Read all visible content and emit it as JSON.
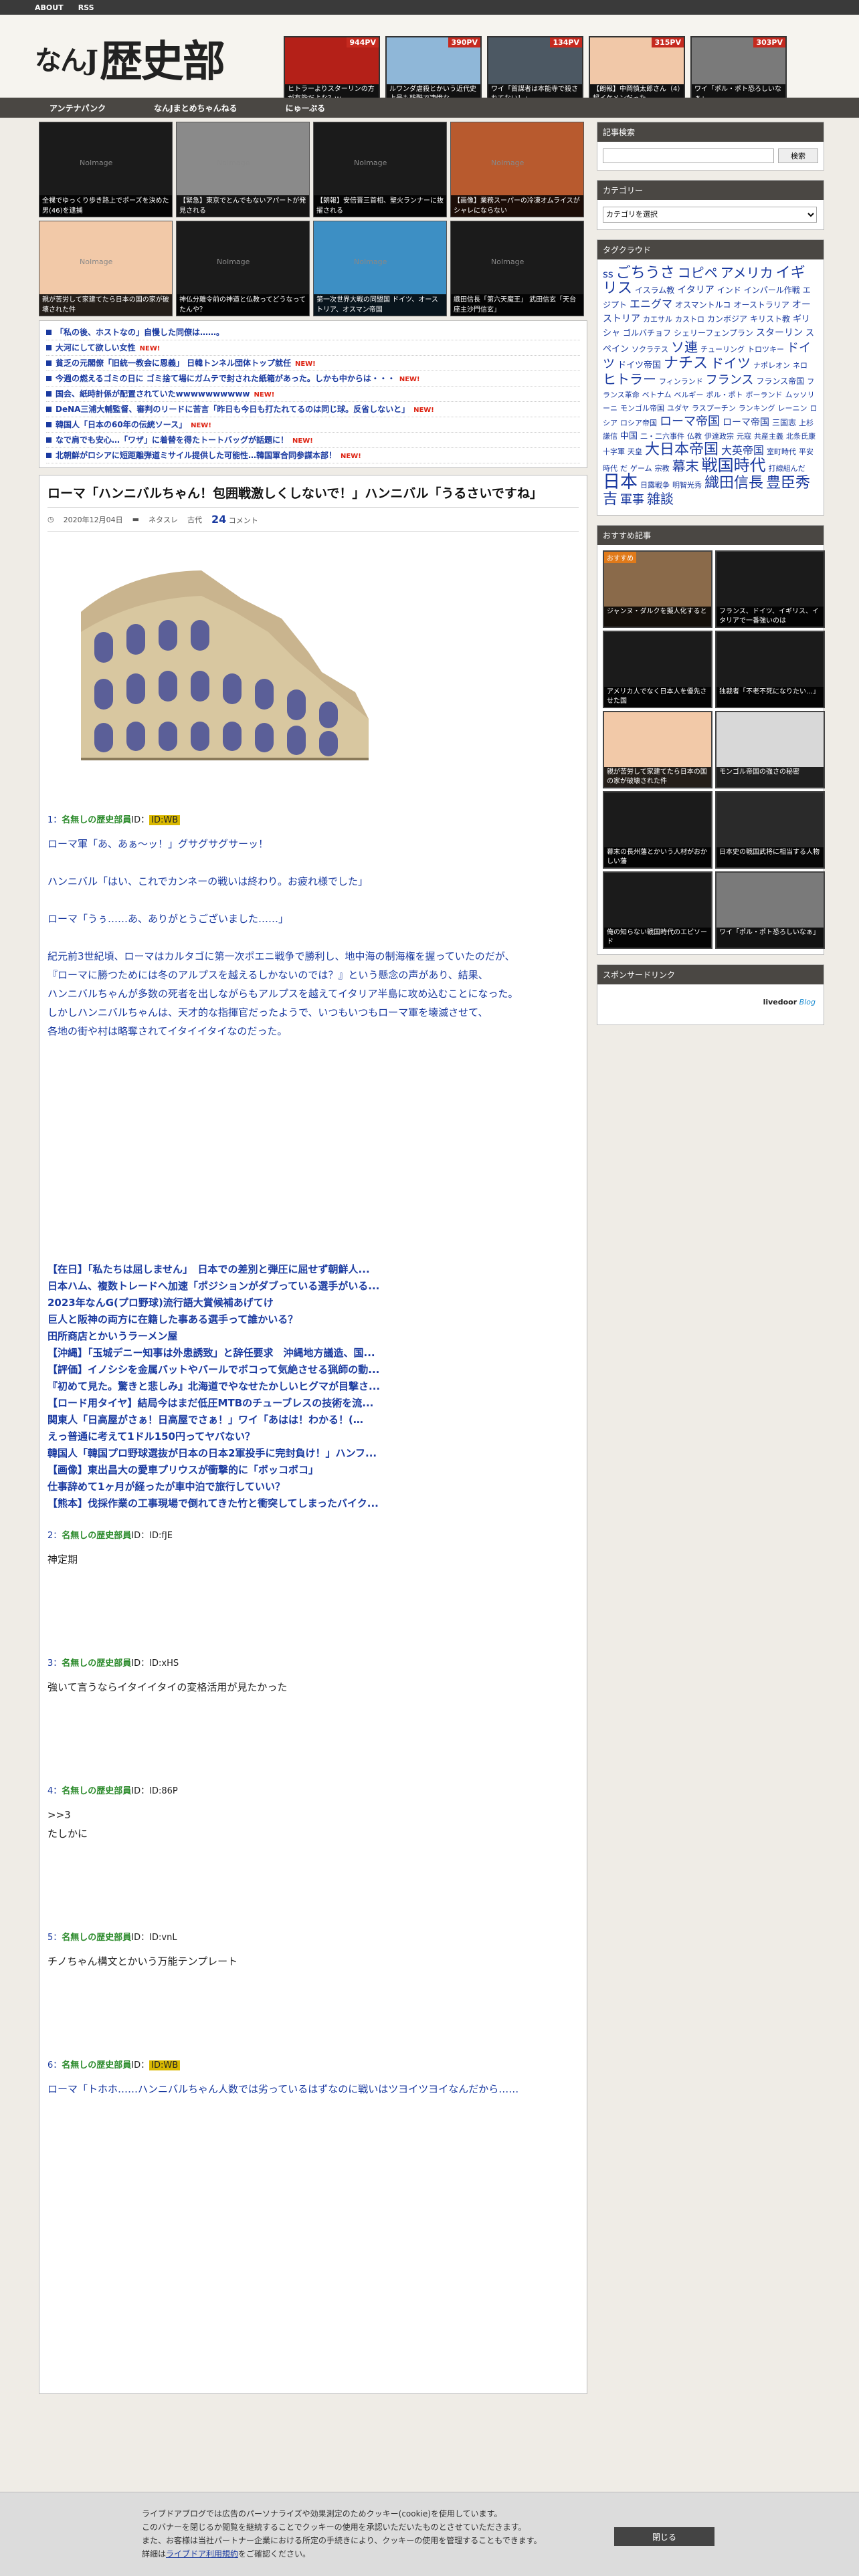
{
  "topbar": {
    "about": "ABOUT",
    "rss": "RSS"
  },
  "logo": {
    "prefix": "なんJ",
    "main": "歴史部"
  },
  "pv_items": [
    {
      "count": "944PV",
      "caption": "ヒトラーよりスターリンの方が有能だよな？ｗ",
      "color": "#b42018"
    },
    {
      "count": "390PV",
      "caption": "ルワンダ虐殺とかいう近代史上最も残酷で凄惨な…",
      "color": "#8fb7d8"
    },
    {
      "count": "134PV",
      "caption": "ワイ「首謀者は本能寺で殺されてない！」",
      "color": "#4c5863"
    },
    {
      "count": "315PV",
      "caption": "【朗報】中岡慎太郎さん（4）超イケメンだった",
      "color": "#f1c8a8"
    },
    {
      "count": "303PV",
      "caption": "ワイ「ポル・ポト恐ろしいなぁ」",
      "color": "#7a7a7a"
    }
  ],
  "nav": [
    "アンテナパンク",
    "なんJまとめちゃんねる",
    "にゅーぷる"
  ],
  "noimage": "NoImage",
  "grid_tiles": [
    {
      "caption": "全裸でゆっくり歩き路上でポーズを決めた男(46)を逮捕",
      "color": "#1b1b1b"
    },
    {
      "caption": "【緊急】東京でとんでもないアパートが発見される",
      "color": "#8a8a8a"
    },
    {
      "caption": "【朗報】安倍晋三首相、聖火ランナーに抜擢される",
      "color": "#1b1b1b"
    },
    {
      "caption": "【画像】業務スーパーの冷凍オムライスがシャレにならない",
      "color": "#b85a2e"
    },
    {
      "caption": "親が苦労して家建てたら日本の国の家が破壊された件",
      "color": "#f2c9a8"
    },
    {
      "caption": "神仏分離令前の神道と仏教ってどうなってたんや？",
      "color": "#1b1b1b"
    },
    {
      "caption": "第一次世界大戦の同盟国 ドイツ、オーストリア、オスマン帝国",
      "color": "#3d8fc4"
    },
    {
      "caption": "織田信長「第六天魔王」 武田信玄「天台座主沙門信玄」",
      "color": "#1b1b1b"
    }
  ],
  "news": [
    {
      "text": "「私の後、ホストなの」自慢した同僚は……。",
      "new": ""
    },
    {
      "text": "大河にして欲しい女性",
      "new": "NEW!"
    },
    {
      "text": "貧乏の元閣僚「旧統一教会に恩義」 日韓トンネル団体トップ就任",
      "new": "NEW!"
    },
    {
      "text": "今週の燃えるゴミの日に ゴミ捨て場にガムテで封された紙箱があった。しかも中からは・・・",
      "new": "NEW!"
    },
    {
      "text": "国会、紙時計係が配置されていたwwwwwwwwww",
      "new": "NEW!"
    },
    {
      "text": "DeNA三浦大輔監督、審判のリードに苦言「昨日も今日も打たれてるのは同じ球。反省しないと」",
      "new": "NEW!"
    },
    {
      "text": "韓国人「日本の60年の伝統ソース」",
      "new": "NEW!"
    },
    {
      "text": "なで肩でも安心…「ワザ」に着替を得たトートバッグが話題に！",
      "new": "NEW!"
    },
    {
      "text": "北朝鮮がロシアに短距離弾道ミサイル提供した可能性…韓国軍合同参謀本部！",
      "new": "NEW!"
    }
  ],
  "article": {
    "title": "ローマ「ハンニバルちゃん！包囲戦激しくしないで！」ハンニバル「うるさいですね」",
    "date": "2020年12月04日",
    "category1": "ネタスレ",
    "category2": "古代",
    "comment_count": "24",
    "comment_label": "コメント"
  },
  "comment_header": {
    "name": "名無しの歴史部員",
    "id_label": "ID："
  },
  "comments": [
    {
      "num": "1：",
      "id": "ID:WB",
      "highlight": true,
      "body": "ローマ軍「あ、あぁ〜ッ！」グサグサグサーッ！\n\nハンニバル「はい、これでカンネーの戦いは終わり。お疲れ様でした」\n\nローマ「うぅ……あ、ありがとうございました……」\n\n紀元前3世紀頃、ローマはカルタゴに第一次ポエニ戦争で勝利し、地中海の制海権を握っていたのだが、\n『ローマに勝つためには冬のアルプスを越えるしかないのでは？』という懸念の声があり、結果、\nハンニバルちゃんが多数の死者を出しながらもアルプスを越えてイタリア半島に攻め込むことになった。\nしかしハンニバルちゃんは、天才的な指揮官だったようで、いつもいつもローマ軍を壊滅させて、\n各地の街や村は略奪されてイタイイタイなのだった。"
    },
    {
      "num": "2：",
      "id": "ID:fJE",
      "highlight": false,
      "body": "神定期"
    },
    {
      "num": "3：",
      "id": "ID:xHS",
      "highlight": false,
      "body": "強いて言うならイタイイタイの変格活用が見たかった"
    },
    {
      "num": "4：",
      "id": "ID:86P",
      "highlight": false,
      "body": ">>3\nたしかに"
    },
    {
      "num": "5：",
      "id": "ID:vnL",
      "highlight": false,
      "body": "チノちゃん構文とかいう万能テンプレート"
    },
    {
      "num": "6：",
      "id": "ID:WB",
      "highlight": true,
      "body": "ローマ「トホホ……ハンニバルちゃん人数では劣っているはずなのに戦いはツヨイツヨイなんだから……"
    }
  ],
  "related_links": [
    "【在日】「私たちは屈しません」　日本での差別と弾圧に屈せず朝鮮人...",
    "日本ハム、複数トレードへ加速「ポジションがダブっている選手がいる...",
    "2023年なんG(プロ野球)流行語大賞候補あげてけ",
    "巨人と阪神の両方に在籍した事ある選手って誰かいる？",
    "田所商店とかいうラーメン屋",
    "【沖縄】「玉城デニー知事は外患誘致」と辞任要求　沖縄地方議造、国...",
    "【評価】イノシシを金属バットやバールでボコって気絶させる猟師の動...",
    "『初めて見た。驚きと悲しみ』北海道でやなせたかしいヒグマが目撃さ...",
    "【ロード用タイヤ】結局今はまだ低圧MTBのチューブレスの技術を流...",
    "関東人「日高屋がさぁ！日高屋でさぁ！」ワイ「あはは！わかる！(…",
    "えっ普通に考えて1ドル150円ってヤバない？",
    "韓国人「韓国プロ野球選抜が日本の日本2軍投手に完封負け！」ハンフ...",
    "【画像】東出昌大の愛車プリウスが衝撃的に「ボッコボコ」",
    "仕事辞めて1ヶ月が経ったが車中泊で旅行していい？",
    "【熊本】伐採作業の工事現場で倒れてきた竹と衝突してしまったバイク..."
  ],
  "sidebar": {
    "search_title": "記事検索",
    "search_button": "検索",
    "category_title": "カテゴリー",
    "category_select": "カテゴリを選択",
    "tag_title": "タグクラウド",
    "tags": [
      "ss",
      "ごちうさ",
      "コピペ",
      "アメリカ",
      "イギリス",
      "イスラム教",
      "イタリア",
      "インド",
      "インパール作戦",
      "エジプト",
      "エニグマ",
      "オスマントルコ",
      "オーストラリア",
      "オーストリア",
      "カエサル",
      "カストロ",
      "カンボジア",
      "キリスト教",
      "ギリシャ",
      "ゴルバチョフ",
      "シェリーフェンプラン",
      "スターリン",
      "スペイン",
      "ソクラテス",
      "ソ連",
      "チューリング",
      "トロツキー",
      "ドイツ",
      "ドイツ帝国",
      "ナチス",
      "ドイツ",
      "ナポレオン",
      "ネロ",
      "ヒトラー",
      "フィンランド",
      "フランス",
      "フランス帝国",
      "フランス革命",
      "ベトナム",
      "ベルギー",
      "ボル・ポト",
      "ボーランド",
      "ムッソリーニ",
      "モンゴル帝国",
      "ユダヤ",
      "ラスプーチン",
      "ランキング",
      "レーニン",
      "ロシア",
      "ロシア帝国",
      "ローマ帝国",
      "ローマ帝国",
      "三国志",
      "上杉謙信",
      "中国",
      "二・二六事件",
      "仏教",
      "伊達政宗",
      "元寇",
      "共産主義",
      "北条氏康",
      "十字軍",
      "天皇",
      "大日本帝国",
      "大英帝国",
      "室町時代",
      "平安時代",
      "だ",
      "ゲーム",
      "宗教",
      "幕末",
      "戦国時代",
      "打線組んだ",
      "日本",
      "日露戦争",
      "明智光秀",
      "織田信長",
      "豊臣秀吉",
      "軍事",
      "雑談"
    ],
    "rec_title": "おすすめ記事",
    "rec_badge": "おすすめ",
    "rec_items": [
      {
        "caption": "ジャンヌ・ダルクを擬人化すると",
        "color": "#8a6a4a"
      },
      {
        "caption": "フランス、ドイツ、イギリス、イタリアで一番強いのは",
        "color": "#1b1b1b"
      },
      {
        "caption": "アメリカ人でなく日本人を優先させた国",
        "color": "#1b1b1b"
      },
      {
        "caption": "独裁者「不老不死になりたい…」",
        "color": "#1b1b1b"
      },
      {
        "caption": "親が苦労して家建てたら日本の国の家が破壊された件",
        "color": "#f2c9a8"
      },
      {
        "caption": "モンゴル帝国の強さの秘密",
        "color": "#d8d8d8"
      },
      {
        "caption": "幕末の長州藩とかいう人材がおかしい藩",
        "color": "#1b1b1b"
      },
      {
        "caption": "日本史の戦国武将に相当する人物",
        "color": "#2a2a2a"
      },
      {
        "caption": "俺の知らない戦国時代のエピソード",
        "color": "#1b1b1b"
      },
      {
        "caption": "ワイ「ポル・ポト恐ろしいなぁ」",
        "color": "#7a7a7a"
      }
    ],
    "sponsor_title": "スポンサードリンク",
    "livedoor": "livedoor",
    "blog": "Blog"
  },
  "cookie": {
    "line1": "ライブドアブログでは広告のパーソナライズや効果測定のためクッキー(cookie)を使用しています。",
    "line2": "このバナーを閉じるか閲覧を継続することでクッキーの使用を承認いただいたものとさせていただきます。",
    "line3": "また、お客様は当社パートナー企業における所定の手続きにより、クッキーの使用を管理することもできます。",
    "line4_pre": "詳細は",
    "line4_link": "ライブドア利用規約",
    "line4_post": "をご確認ください。",
    "close": "閉じる"
  }
}
